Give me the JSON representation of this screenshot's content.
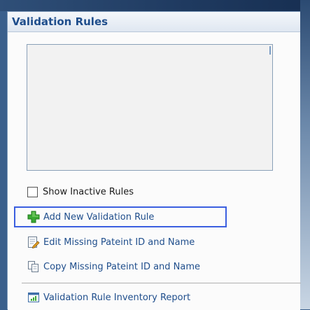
{
  "panel": {
    "title": "Validation Rules",
    "show_inactive_label": "Show Inactive Rules",
    "show_inactive_checked": false
  },
  "actions": {
    "add_label": "Add New Validation Rule",
    "edit_label": "Edit Missing Pateint ID and Name",
    "copy_label": "Copy Missing Pateint ID and Name",
    "report_label": "Validation Rule Inventory Report"
  },
  "icons": {
    "add": "plus-icon",
    "edit": "edit-document-icon",
    "copy": "copy-document-icon",
    "report": "report-chart-icon"
  },
  "colors": {
    "title": "#1f4e8c",
    "link": "#1f4e8c",
    "highlight": "#3b5fe0",
    "add_green": "#3aa934"
  }
}
